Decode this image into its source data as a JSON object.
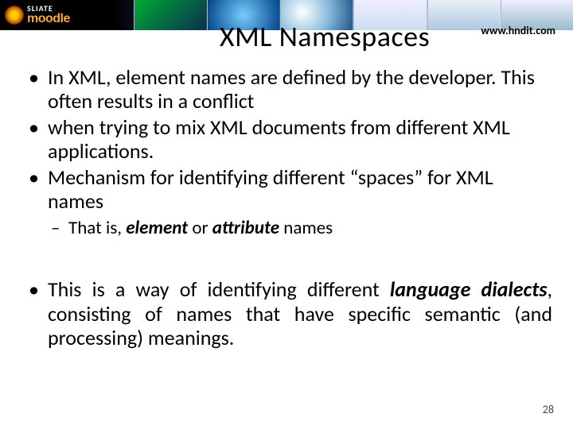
{
  "header": {
    "logo_top": "SLIATE",
    "logo_bottom": "moodle"
  },
  "title": "XML Namespaces",
  "url": "www.hndit.com",
  "bullets": {
    "b1": "In XML, element names are defined by the developer. This often results in a conflict",
    "b2": "when trying to mix XML documents from different XML applications.",
    "b3": "Mechanism for identifying different “spaces” for XML names",
    "sub_pre": "That is, ",
    "sub_el": "element",
    "sub_or": " or ",
    "sub_attr": "attribute",
    "sub_post": " names",
    "b4_pre": "This is a way of identifying different ",
    "b4_lang": "language dialects",
    "b4_post": ", consisting of names that have specific semantic (and processing) meanings."
  },
  "page": "28"
}
